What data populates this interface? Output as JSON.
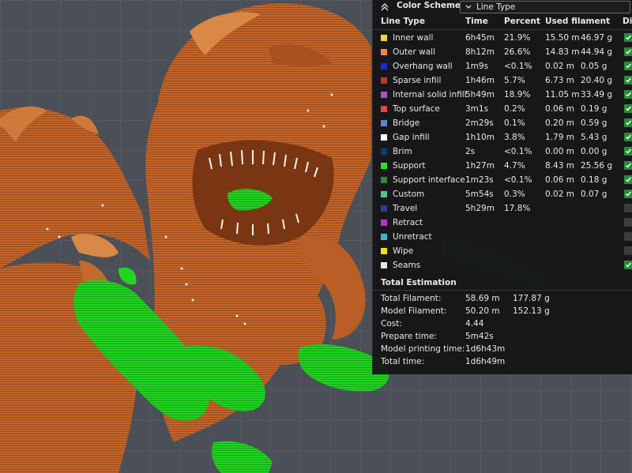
{
  "panel": {
    "scheme_label": "Color Scheme",
    "scheme_value": "Line Type",
    "headers": {
      "line_type": "Line Type",
      "time": "Time",
      "percent": "Percent",
      "used": "Used filament",
      "display": "Dis"
    },
    "rows": [
      {
        "name": "Inner wall",
        "color": "#f5d438",
        "time": "6h45m",
        "percent": "21.9%",
        "len": "15.50 m",
        "wt": "46.97 g",
        "checked": true
      },
      {
        "name": "Outer wall",
        "color": "#f2893a",
        "time": "8h12m",
        "percent": "26.6%",
        "len": "14.83 m",
        "wt": "44.94 g",
        "checked": true
      },
      {
        "name": "Overhang wall",
        "color": "#1f25d8",
        "time": "1m9s",
        "percent": "<0.1%",
        "len": "0.02 m",
        "wt": "0.05 g",
        "checked": true
      },
      {
        "name": "Sparse infill",
        "color": "#b83a2e",
        "time": "1h46m",
        "percent": "5.7%",
        "len": "6.73 m",
        "wt": "20.40 g",
        "checked": true
      },
      {
        "name": "Internal solid infill",
        "color": "#a94fd0",
        "time": "5h49m",
        "percent": "18.9%",
        "len": "11.05 m",
        "wt": "33.49 g",
        "checked": true
      },
      {
        "name": "Top surface",
        "color": "#e8434a",
        "time": "3m1s",
        "percent": "0.2%",
        "len": "0.06 m",
        "wt": "0.19 g",
        "checked": true
      },
      {
        "name": "Bridge",
        "color": "#5f86c0",
        "time": "2m29s",
        "percent": "0.1%",
        "len": "0.20 m",
        "wt": "0.59 g",
        "checked": true
      },
      {
        "name": "Gap infill",
        "color": "#ffffff",
        "time": "1h10m",
        "percent": "3.8%",
        "len": "1.79 m",
        "wt": "5.43 g",
        "checked": true
      },
      {
        "name": "Brim",
        "color": "#0f3d6e",
        "time": "2s",
        "percent": "<0.1%",
        "len": "0.00 m",
        "wt": "0.00 g",
        "checked": true
      },
      {
        "name": "Support",
        "color": "#29e02a",
        "time": "1h27m",
        "percent": "4.7%",
        "len": "8.43 m",
        "wt": "25.56 g",
        "checked": true
      },
      {
        "name": "Support interface",
        "color": "#2e8a3a",
        "time": "1m23s",
        "percent": "<0.1%",
        "len": "0.06 m",
        "wt": "0.18 g",
        "checked": true
      },
      {
        "name": "Custom",
        "color": "#4fc49a",
        "time": "5m54s",
        "percent": "0.3%",
        "len": "0.02 m",
        "wt": "0.07 g",
        "checked": true
      },
      {
        "name": "Travel",
        "color": "#2f3a9e",
        "time": "5h29m",
        "percent": "17.8%",
        "len": "",
        "wt": "",
        "checked": false
      },
      {
        "name": "Retract",
        "color": "#c02fc0",
        "time": "",
        "percent": "",
        "len": "",
        "wt": "",
        "checked": false
      },
      {
        "name": "Unretract",
        "color": "#3fb2cf",
        "time": "",
        "percent": "",
        "len": "",
        "wt": "",
        "checked": false
      },
      {
        "name": "Wipe",
        "color": "#f2e21a",
        "time": "",
        "percent": "",
        "len": "",
        "wt": "",
        "checked": false
      },
      {
        "name": "Seams",
        "color": "#e6e6e6",
        "time": "",
        "percent": "",
        "len": "",
        "wt": "",
        "checked": true
      }
    ],
    "total_title": "Total Estimation",
    "totals": [
      {
        "label": "Total Filament:",
        "v1": "58.69 m",
        "v2": "177.87 g"
      },
      {
        "label": "Model Filament:",
        "v1": "50.20 m",
        "v2": "152.13 g"
      },
      {
        "label": "Cost:",
        "v1": "4.44",
        "v2": ""
      },
      {
        "label": "Prepare time:",
        "v1": "5m42s",
        "v2": ""
      },
      {
        "label": "Model printing time:",
        "v1": "1d6h43m",
        "v2": ""
      },
      {
        "label": "Total time:",
        "v1": "1d6h49m",
        "v2": ""
      }
    ]
  }
}
